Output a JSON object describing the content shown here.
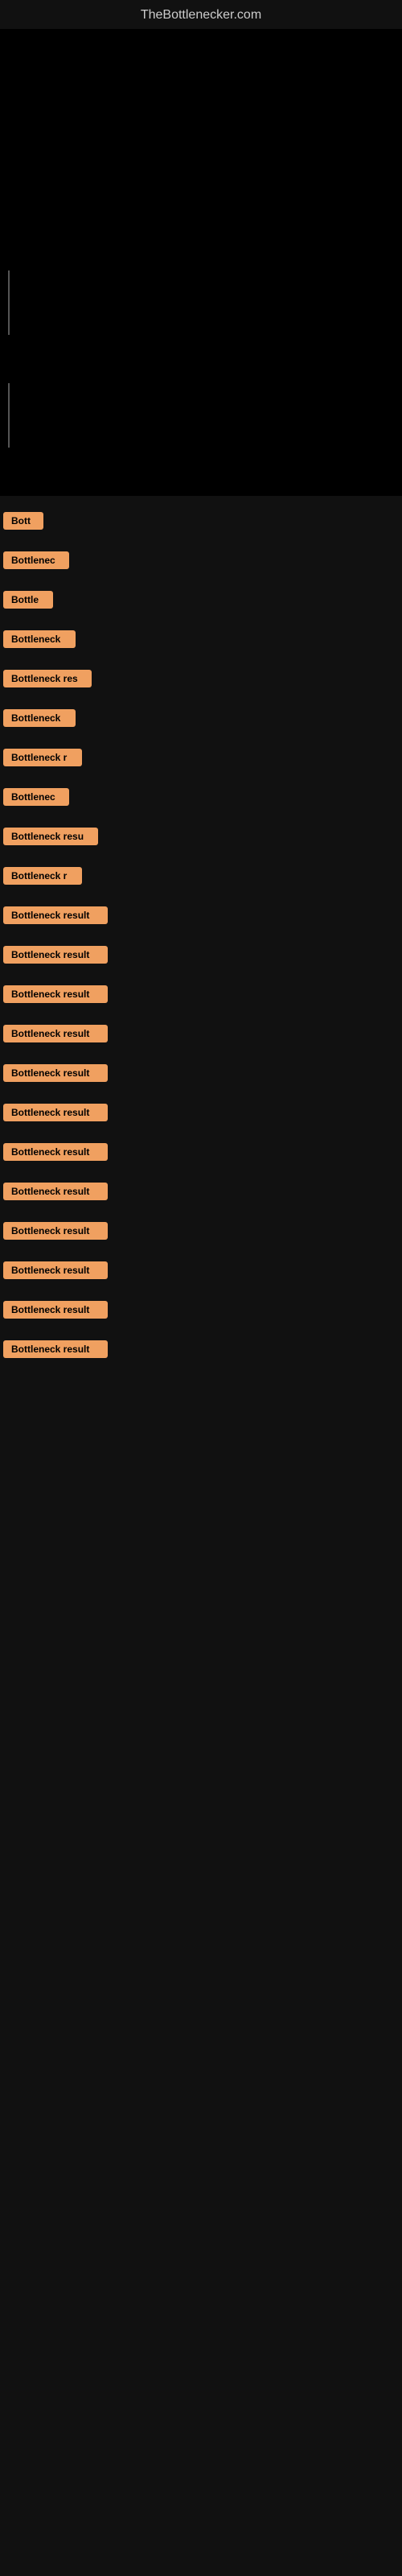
{
  "header": {
    "site_title": "TheBottlenecker.com"
  },
  "results": [
    {
      "id": 1,
      "label": "Bott",
      "width": 50
    },
    {
      "id": 2,
      "label": "Bottlenec",
      "width": 82
    },
    {
      "id": 3,
      "label": "Bottle",
      "width": 62
    },
    {
      "id": 4,
      "label": "Bottleneck",
      "width": 90
    },
    {
      "id": 5,
      "label": "Bottleneck res",
      "width": 110
    },
    {
      "id": 6,
      "label": "Bottleneck",
      "width": 90
    },
    {
      "id": 7,
      "label": "Bottleneck r",
      "width": 98
    },
    {
      "id": 8,
      "label": "Bottlenec",
      "width": 82
    },
    {
      "id": 9,
      "label": "Bottleneck resu",
      "width": 118
    },
    {
      "id": 10,
      "label": "Bottleneck r",
      "width": 98
    },
    {
      "id": 11,
      "label": "Bottleneck result",
      "width": 130
    },
    {
      "id": 12,
      "label": "Bottleneck result",
      "width": 130
    },
    {
      "id": 13,
      "label": "Bottleneck result",
      "width": 130
    },
    {
      "id": 14,
      "label": "Bottleneck result",
      "width": 130
    },
    {
      "id": 15,
      "label": "Bottleneck result",
      "width": 130
    },
    {
      "id": 16,
      "label": "Bottleneck result",
      "width": 130
    },
    {
      "id": 17,
      "label": "Bottleneck result",
      "width": 130
    },
    {
      "id": 18,
      "label": "Bottleneck result",
      "width": 130
    },
    {
      "id": 19,
      "label": "Bottleneck result",
      "width": 130
    },
    {
      "id": 20,
      "label": "Bottleneck result",
      "width": 130
    },
    {
      "id": 21,
      "label": "Bottleneck result",
      "width": 130
    },
    {
      "id": 22,
      "label": "Bottleneck result",
      "width": 130
    }
  ],
  "colors": {
    "background": "#111111",
    "badge_bg": "#f0a060",
    "badge_text": "#000000",
    "title_text": "#cccccc"
  }
}
